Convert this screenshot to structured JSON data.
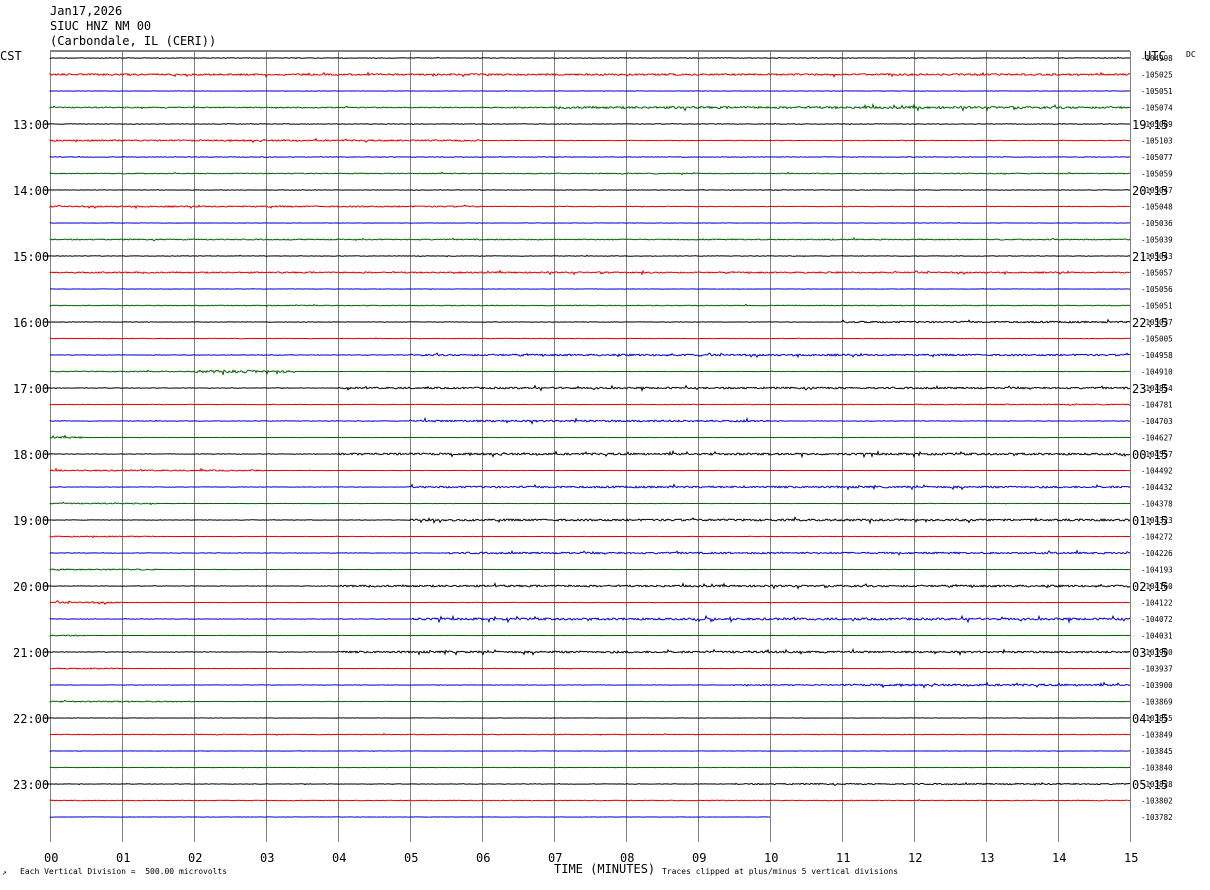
{
  "header": {
    "date": "Jan17,2026",
    "station": "SIUC HNZ NM 00",
    "location": "(Carbondale, IL (CERI))"
  },
  "labels": {
    "left_tz": "CST",
    "right_tz": "UTC",
    "dc": "DC",
    "xlabel": "TIME (MINUTES)",
    "scale_note": "Each Vertical Division =  500.00 microvolts",
    "clip_note": "Traces clipped at plus/minus 5 vertical divisions",
    "corner_mark": "↗"
  },
  "colors": {
    "black": "#000000",
    "red": "#e00000",
    "blue": "#0000c8",
    "green": "#006400",
    "grid": "#808080"
  },
  "chart_data": {
    "type": "line",
    "title": "SIUC HNZ NM 00",
    "xlabel": "TIME (MINUTES)",
    "x_ticks": [
      "00",
      "01",
      "02",
      "03",
      "04",
      "05",
      "06",
      "07",
      "08",
      "09",
      "10",
      "11",
      "12",
      "13",
      "14",
      "15"
    ],
    "xlim": [
      0,
      15
    ],
    "left_time_labels": [
      "13:00",
      "14:00",
      "15:00",
      "16:00",
      "17:00",
      "18:00",
      "19:00",
      "20:00",
      "21:00",
      "22:00",
      "23:00"
    ],
    "right_time_labels": [
      "19:15",
      "20:15",
      "21:15",
      "22:15",
      "23:15",
      "00:15",
      "01:15",
      "02:15",
      "03:15",
      "04:15",
      "05:15"
    ],
    "color_cycle": [
      "black",
      "red",
      "blue",
      "green"
    ],
    "traces": [
      {
        "dc": "-104998",
        "activity": [
          [
            0,
            15,
            0.5
          ]
        ]
      },
      {
        "dc": "-105025",
        "activity": [
          [
            0,
            15,
            1.6
          ]
        ]
      },
      {
        "dc": "-105051",
        "activity": [
          [
            0,
            15,
            0.3
          ]
        ]
      },
      {
        "dc": "-105074",
        "activity": [
          [
            0,
            7,
            1.0
          ],
          [
            7,
            15,
            2.0
          ]
        ]
      },
      {
        "dc": "-105089",
        "activity": [
          [
            0,
            15,
            0.5
          ]
        ]
      },
      {
        "dc": "-105103",
        "activity": [
          [
            0,
            6,
            1.4
          ],
          [
            6,
            15,
            0.4
          ]
        ]
      },
      {
        "dc": "-105077",
        "activity": [
          [
            0,
            15,
            0.5
          ]
        ]
      },
      {
        "dc": "-105059",
        "activity": [
          [
            0,
            15,
            0.8
          ]
        ]
      },
      {
        "dc": "-105047",
        "activity": [
          [
            0,
            15,
            0.4
          ]
        ]
      },
      {
        "dc": "-105048",
        "activity": [
          [
            0,
            6,
            1.3
          ],
          [
            6,
            15,
            0.4
          ]
        ]
      },
      {
        "dc": "-105036",
        "activity": [
          [
            0,
            15,
            0.3
          ]
        ]
      },
      {
        "dc": "-105039",
        "activity": [
          [
            0,
            15,
            1.0
          ]
        ]
      },
      {
        "dc": "-105043",
        "activity": [
          [
            0,
            15,
            0.5
          ]
        ]
      },
      {
        "dc": "-105057",
        "activity": [
          [
            0,
            15,
            1.3
          ]
        ]
      },
      {
        "dc": "-105056",
        "activity": [
          [
            0,
            15,
            0.3
          ]
        ]
      },
      {
        "dc": "-105051",
        "activity": [
          [
            0,
            15,
            0.7
          ]
        ]
      },
      {
        "dc": "-105037",
        "activity": [
          [
            0,
            11,
            0.4
          ],
          [
            11,
            15,
            1.5
          ]
        ]
      },
      {
        "dc": "-105005",
        "activity": [
          [
            0,
            15,
            0.4
          ]
        ]
      },
      {
        "dc": "-104958",
        "activity": [
          [
            0,
            5,
            0.4
          ],
          [
            5,
            15,
            1.6
          ]
        ]
      },
      {
        "dc": "-104910",
        "activity": [
          [
            0,
            2,
            0.8
          ],
          [
            2,
            3.4,
            2.4
          ],
          [
            3.4,
            15,
            0.3
          ]
        ]
      },
      {
        "dc": "-104854",
        "activity": [
          [
            0,
            4,
            0.4
          ],
          [
            4,
            15,
            1.6
          ]
        ]
      },
      {
        "dc": "-104781",
        "activity": [
          [
            0,
            12,
            0.4
          ],
          [
            12,
            15,
            0.9
          ]
        ]
      },
      {
        "dc": "-104703",
        "activity": [
          [
            0,
            5,
            0.4
          ],
          [
            5,
            10,
            1.8
          ],
          [
            10,
            15,
            0.4
          ]
        ]
      },
      {
        "dc": "-104627",
        "activity": [
          [
            0,
            0.5,
            1.5
          ],
          [
            0.5,
            15,
            0.2
          ]
        ]
      },
      {
        "dc": "-104557",
        "activity": [
          [
            0,
            4,
            0.4
          ],
          [
            4,
            15,
            1.9
          ]
        ]
      },
      {
        "dc": "-104492",
        "activity": [
          [
            0,
            3,
            1.2
          ],
          [
            3,
            15,
            0.3
          ]
        ]
      },
      {
        "dc": "-104432",
        "activity": [
          [
            0,
            5,
            0.4
          ],
          [
            5,
            15,
            1.7
          ]
        ]
      },
      {
        "dc": "-104378",
        "activity": [
          [
            0,
            1.5,
            1.0
          ],
          [
            1.5,
            15,
            0.2
          ]
        ]
      },
      {
        "dc": "-104323",
        "activity": [
          [
            0,
            5,
            0.4
          ],
          [
            5,
            15,
            1.9
          ]
        ]
      },
      {
        "dc": "-104272",
        "activity": [
          [
            0,
            1.5,
            1.0
          ],
          [
            1.5,
            15,
            0.3
          ]
        ]
      },
      {
        "dc": "-104226",
        "activity": [
          [
            0,
            5.5,
            0.4
          ],
          [
            5.5,
            15,
            1.6
          ]
        ]
      },
      {
        "dc": "-104193",
        "activity": [
          [
            0,
            1.5,
            1.1
          ],
          [
            1.5,
            15,
            0.2
          ]
        ]
      },
      {
        "dc": "-104160",
        "activity": [
          [
            0,
            4,
            0.4
          ],
          [
            4,
            15,
            1.7
          ]
        ]
      },
      {
        "dc": "-104122",
        "activity": [
          [
            0,
            1,
            1.4
          ],
          [
            1,
            15,
            0.3
          ]
        ]
      },
      {
        "dc": "-104072",
        "activity": [
          [
            0,
            5,
            0.4
          ],
          [
            5,
            15,
            2.0
          ]
        ]
      },
      {
        "dc": "-104031",
        "activity": [
          [
            0,
            0.5,
            1.0
          ],
          [
            0.5,
            15,
            0.2
          ]
        ]
      },
      {
        "dc": "-103980",
        "activity": [
          [
            0,
            4,
            0.4
          ],
          [
            4,
            15,
            1.8
          ]
        ]
      },
      {
        "dc": "-103937",
        "activity": [
          [
            0,
            1,
            1.0
          ],
          [
            1,
            15,
            0.3
          ]
        ]
      },
      {
        "dc": "-103900",
        "activity": [
          [
            0,
            9.5,
            0.3
          ],
          [
            9.5,
            11,
            1.0
          ],
          [
            11,
            15,
            1.8
          ]
        ]
      },
      {
        "dc": "-103869",
        "activity": [
          [
            0,
            2,
            1.0
          ],
          [
            2,
            15,
            0.2
          ]
        ]
      },
      {
        "dc": "-103855",
        "activity": [
          [
            0,
            15,
            0.3
          ]
        ]
      },
      {
        "dc": "-103849",
        "activity": [
          [
            0,
            15,
            0.6
          ]
        ]
      },
      {
        "dc": "-103845",
        "activity": [
          [
            0,
            15,
            0.2
          ]
        ]
      },
      {
        "dc": "-103840",
        "activity": [
          [
            0,
            15,
            0.3
          ]
        ]
      },
      {
        "dc": "-103828",
        "activity": [
          [
            0,
            9.5,
            0.4
          ],
          [
            9.5,
            15,
            1.2
          ]
        ]
      },
      {
        "dc": "-103802",
        "activity": [
          [
            0,
            15,
            0.6
          ]
        ]
      },
      {
        "dc": "-103782",
        "activity": [
          [
            0,
            10,
            0.3
          ]
        ]
      }
    ]
  }
}
